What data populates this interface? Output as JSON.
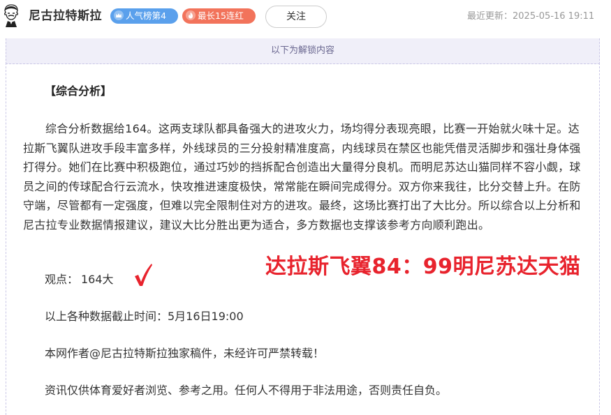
{
  "header": {
    "author_name": "尼古拉特斯拉",
    "badge_popularity": "人气榜第4",
    "badge_streak": "最长15连红",
    "follow_label": "关注",
    "update_time": "最近更新：2025-05-16 19:11",
    "colors": {
      "badge_popularity": "#5aa0ec",
      "badge_streak": "#f2735b"
    }
  },
  "content": {
    "unlock_notice": "以下为解锁内容",
    "section_title": "【综合分析】",
    "analysis": "综合分析数据给164。这两支球队都具备强大的进攻火力，场均得分表现亮眼，比赛一开始就火味十足。达拉斯飞翼队进攻手段丰富多样，外线球员的三分投射精准度高，内线球员在禁区也能凭借灵活脚步和强壮身体强打得分。她们在比赛中积极跑位，通过巧妙的挡拆配合创造出大量得分良机。而明尼苏达山猫同样不容小觑，球员之间的传球配合行云流水，快攻推进速度极快，常常能在瞬间完成得分。双方你来我往，比分交替上升。在防守端，尽管都有一定强度，但难以完全限制住对方的进攻。最终，这场比赛打出了大比分。所以综合以上分析和尼古拉专业数据情报建议，建议大比分胜出更为适合，多方数据也支撑该参考方向顺利跑出。",
    "viewpoint_label": "观点：",
    "viewpoint_value": "164大",
    "result_overlay": "达拉斯飞翼84：99明尼苏达天猫",
    "data_cutoff": "以上各种数据截止时间：5月16日19:00",
    "copyright": "本网作者@尼古拉特斯拉独家稿件，未经许可严禁转载！",
    "disclaimer": "资讯仅供体育爱好者浏览、参考之用。任何人不得用于非法用途，否则责任自负。",
    "colors": {
      "overlay": "#e8232d",
      "checkmark": "#e8232d"
    }
  }
}
